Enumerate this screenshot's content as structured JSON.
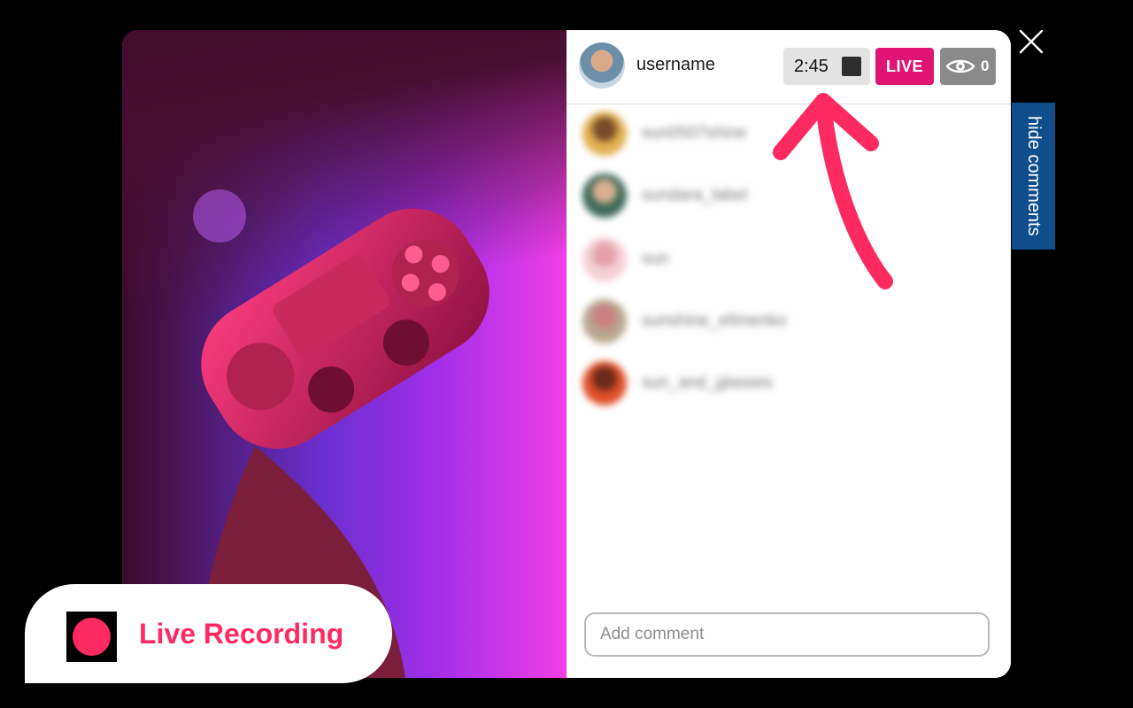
{
  "header": {
    "username": "username",
    "timer": "2:45",
    "live_label": "LIVE",
    "viewer_count": "0"
  },
  "comments": [
    {
      "name": "sun0507shine"
    },
    {
      "name": "sundara_label"
    },
    {
      "name": "sun"
    },
    {
      "name": "sunshine_efimenko"
    },
    {
      "name": "sun_and_glasses"
    }
  ],
  "input": {
    "placeholder": "Add comment"
  },
  "sidebar_toggle": {
    "label": "hide comments"
  },
  "recording": {
    "label": "Live Recording"
  },
  "icons": {
    "close": "close-icon",
    "eye": "eye-icon",
    "stop": "stop-icon",
    "record": "record-icon"
  },
  "colors": {
    "live_badge": "#df1473",
    "accent_pink": "#ff2a62",
    "hide_comments_bg": "#0f4e8a",
    "viewers_bg": "#8a8a8a"
  }
}
